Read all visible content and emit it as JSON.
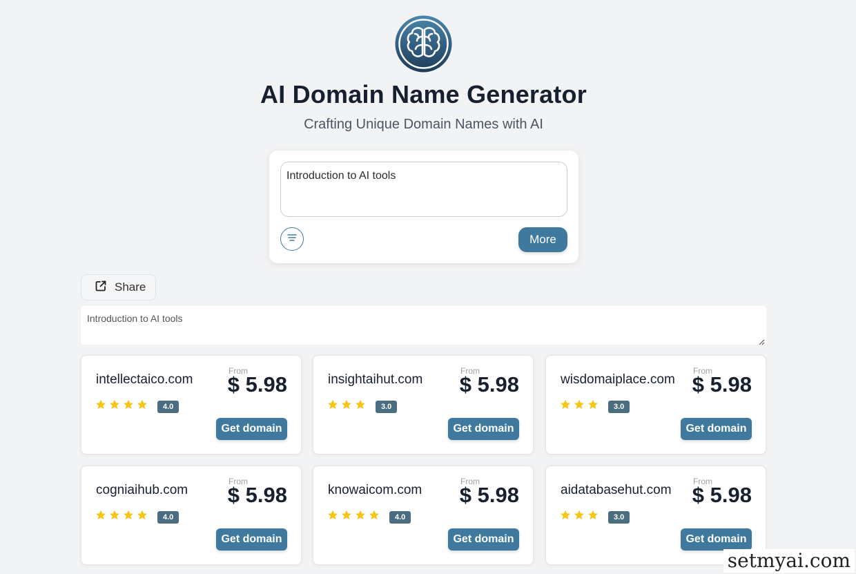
{
  "header": {
    "logo_icon": "brain-icon",
    "title": "AI Domain Name Generator",
    "subtitle": "Crafting Unique Domain Names with AI"
  },
  "prompt": {
    "value": "Introduction to AI tools",
    "filter_icon": "filter-lines-icon",
    "more_label": "More"
  },
  "share": {
    "icon": "external-link-icon",
    "label": "Share"
  },
  "query": {
    "value": "Introduction to AI tools"
  },
  "results": [
    {
      "domain": "intellectaico.com",
      "from_label": "From",
      "price": "$ 5.98",
      "stars": 4,
      "rating": "4.0",
      "button": "Get domain"
    },
    {
      "domain": "insightaihut.com",
      "from_label": "From",
      "price": "$ 5.98",
      "stars": 3,
      "rating": "3.0",
      "button": "Get domain"
    },
    {
      "domain": "wisdomaiplace.com",
      "from_label": "From",
      "price": "$ 5.98",
      "stars": 3,
      "rating": "3.0",
      "button": "Get domain"
    },
    {
      "domain": "cogniaihub.com",
      "from_label": "From",
      "price": "$ 5.98",
      "stars": 4,
      "rating": "4.0",
      "button": "Get domain"
    },
    {
      "domain": "knowaicom.com",
      "from_label": "From",
      "price": "$ 5.98",
      "stars": 4,
      "rating": "4.0",
      "button": "Get domain"
    },
    {
      "domain": "aidatabasehut.com",
      "from_label": "From",
      "price": "$ 5.98",
      "stars": 3,
      "rating": "3.0",
      "button": "Get domain"
    }
  ],
  "colors": {
    "accent": "#3f7a9e",
    "star": "#f5c518",
    "badge": "#4b6d82"
  },
  "watermark": "setmyai.com"
}
